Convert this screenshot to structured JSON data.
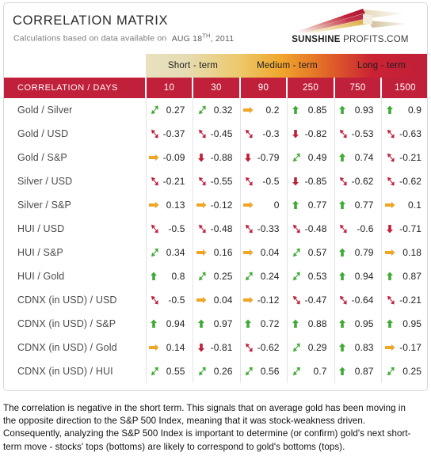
{
  "header": {
    "title": "CORRELATION MATRIX",
    "subtitle_prefix": "Calculations based on data available on",
    "date_main": "AUG 18",
    "date_sup": "TH",
    "date_year": ", 2011",
    "logo_bold": "SUNSHINE",
    "logo_rest": " PROFITS.COM"
  },
  "colors": {
    "accent_red": "#c0203a",
    "positive_green": "#3faa36",
    "neutral_orange": "#f0a525",
    "negative_red": "#c0203a",
    "grid": "#e4e4e4"
  },
  "terms": [
    {
      "label": "Short - term"
    },
    {
      "label": "Medium - term"
    },
    {
      "label": "Long - term"
    }
  ],
  "table": {
    "corner_label": "CORRELATION / DAYS",
    "day_columns": [
      "10",
      "30",
      "90",
      "250",
      "750",
      "1500"
    ],
    "rows": [
      {
        "label": "Gold / Silver",
        "cells": [
          {
            "value": "0.27",
            "arrow": "up-right-green"
          },
          {
            "value": "0.32",
            "arrow": "up-right-green"
          },
          {
            "value": "0.2",
            "arrow": "right-orange"
          },
          {
            "value": "0.85",
            "arrow": "up-green"
          },
          {
            "value": "0.93",
            "arrow": "up-green"
          },
          {
            "value": "0.9",
            "arrow": "up-green"
          }
        ]
      },
      {
        "label": "Gold / USD",
        "cells": [
          {
            "value": "-0.37",
            "arrow": "down-right-red"
          },
          {
            "value": "-0.45",
            "arrow": "down-right-red"
          },
          {
            "value": "-0.3",
            "arrow": "down-right-red"
          },
          {
            "value": "-0.82",
            "arrow": "down-red"
          },
          {
            "value": "-0.53",
            "arrow": "down-right-red"
          },
          {
            "value": "-0.63",
            "arrow": "down-right-red"
          }
        ]
      },
      {
        "label": "Gold / S&P",
        "cells": [
          {
            "value": "-0.09",
            "arrow": "right-orange"
          },
          {
            "value": "-0.88",
            "arrow": "down-red"
          },
          {
            "value": "-0.79",
            "arrow": "down-red"
          },
          {
            "value": "0.49",
            "arrow": "up-right-green"
          },
          {
            "value": "0.74",
            "arrow": "up-green"
          },
          {
            "value": "-0.21",
            "arrow": "down-right-red"
          }
        ]
      },
      {
        "label": "Silver / USD",
        "cells": [
          {
            "value": "-0.21",
            "arrow": "down-right-red"
          },
          {
            "value": "-0.55",
            "arrow": "down-right-red"
          },
          {
            "value": "-0.5",
            "arrow": "down-right-red"
          },
          {
            "value": "-0.85",
            "arrow": "down-red"
          },
          {
            "value": "-0.62",
            "arrow": "down-right-red"
          },
          {
            "value": "-0.62",
            "arrow": "down-right-red"
          }
        ]
      },
      {
        "label": "Silver / S&P",
        "cells": [
          {
            "value": "0.13",
            "arrow": "right-orange"
          },
          {
            "value": "-0.12",
            "arrow": "right-orange"
          },
          {
            "value": "0",
            "arrow": "right-orange"
          },
          {
            "value": "0.77",
            "arrow": "up-green"
          },
          {
            "value": "0.77",
            "arrow": "up-green"
          },
          {
            "value": "0.1",
            "arrow": "right-orange"
          }
        ]
      },
      {
        "label": "HUI / USD",
        "cells": [
          {
            "value": "-0.5",
            "arrow": "down-right-red"
          },
          {
            "value": "-0.48",
            "arrow": "down-right-red"
          },
          {
            "value": "-0.33",
            "arrow": "down-right-red"
          },
          {
            "value": "-0.48",
            "arrow": "down-right-red"
          },
          {
            "value": "-0.6",
            "arrow": "down-right-red"
          },
          {
            "value": "-0.71",
            "arrow": "down-red"
          }
        ]
      },
      {
        "label": "HUI / S&P",
        "cells": [
          {
            "value": "0.34",
            "arrow": "up-right-green"
          },
          {
            "value": "0.16",
            "arrow": "right-orange"
          },
          {
            "value": "0.04",
            "arrow": "right-orange"
          },
          {
            "value": "0.57",
            "arrow": "up-right-green"
          },
          {
            "value": "0.79",
            "arrow": "up-green"
          },
          {
            "value": "0.18",
            "arrow": "right-orange"
          }
        ]
      },
      {
        "label": "HUI / Gold",
        "cells": [
          {
            "value": "0.8",
            "arrow": "up-green"
          },
          {
            "value": "0.25",
            "arrow": "up-right-green"
          },
          {
            "value": "0.24",
            "arrow": "up-right-green"
          },
          {
            "value": "0.53",
            "arrow": "up-right-green"
          },
          {
            "value": "0.94",
            "arrow": "up-green"
          },
          {
            "value": "0.87",
            "arrow": "up-green"
          }
        ]
      },
      {
        "label": "CDNX (in USD) / USD",
        "cells": [
          {
            "value": "-0.5",
            "arrow": "down-right-red"
          },
          {
            "value": "0.04",
            "arrow": "right-orange"
          },
          {
            "value": "-0.12",
            "arrow": "right-orange"
          },
          {
            "value": "-0.47",
            "arrow": "down-right-red"
          },
          {
            "value": "-0.64",
            "arrow": "down-right-red"
          },
          {
            "value": "-0.21",
            "arrow": "down-right-red"
          }
        ]
      },
      {
        "label": "CDNX (in USD) / S&P",
        "cells": [
          {
            "value": "0.94",
            "arrow": "up-green"
          },
          {
            "value": "0.97",
            "arrow": "up-green"
          },
          {
            "value": "0.72",
            "arrow": "up-green"
          },
          {
            "value": "0.88",
            "arrow": "up-green"
          },
          {
            "value": "0.95",
            "arrow": "up-green"
          },
          {
            "value": "0.95",
            "arrow": "up-green"
          }
        ]
      },
      {
        "label": "CDNX (in USD) / Gold",
        "cells": [
          {
            "value": "0.14",
            "arrow": "right-orange"
          },
          {
            "value": "-0.81",
            "arrow": "down-red"
          },
          {
            "value": "-0.62",
            "arrow": "down-right-red"
          },
          {
            "value": "0.29",
            "arrow": "up-right-green"
          },
          {
            "value": "0.83",
            "arrow": "up-green"
          },
          {
            "value": "-0.17",
            "arrow": "right-orange"
          }
        ]
      },
      {
        "label": "CDNX (in USD) / HUI",
        "cells": [
          {
            "value": "0.55",
            "arrow": "up-right-green"
          },
          {
            "value": "0.26",
            "arrow": "up-right-green"
          },
          {
            "value": "0.56",
            "arrow": "up-right-green"
          },
          {
            "value": "0.7",
            "arrow": "up-right-green"
          },
          {
            "value": "0.87",
            "arrow": "up-green"
          },
          {
            "value": "0.25",
            "arrow": "up-right-green"
          }
        ]
      }
    ]
  },
  "footnote": "The correlation is negative in the short term. This signals that on average gold has been moving in the opposite direction to the S&P 500 Index, meaning that it was stock-weakness driven. Consequently, analyzing the S&P 500 Index is important to determine (or confirm) gold's next short-term move - stocks' tops (bottoms) are likely to correspond to gold's bottoms (tops)."
}
